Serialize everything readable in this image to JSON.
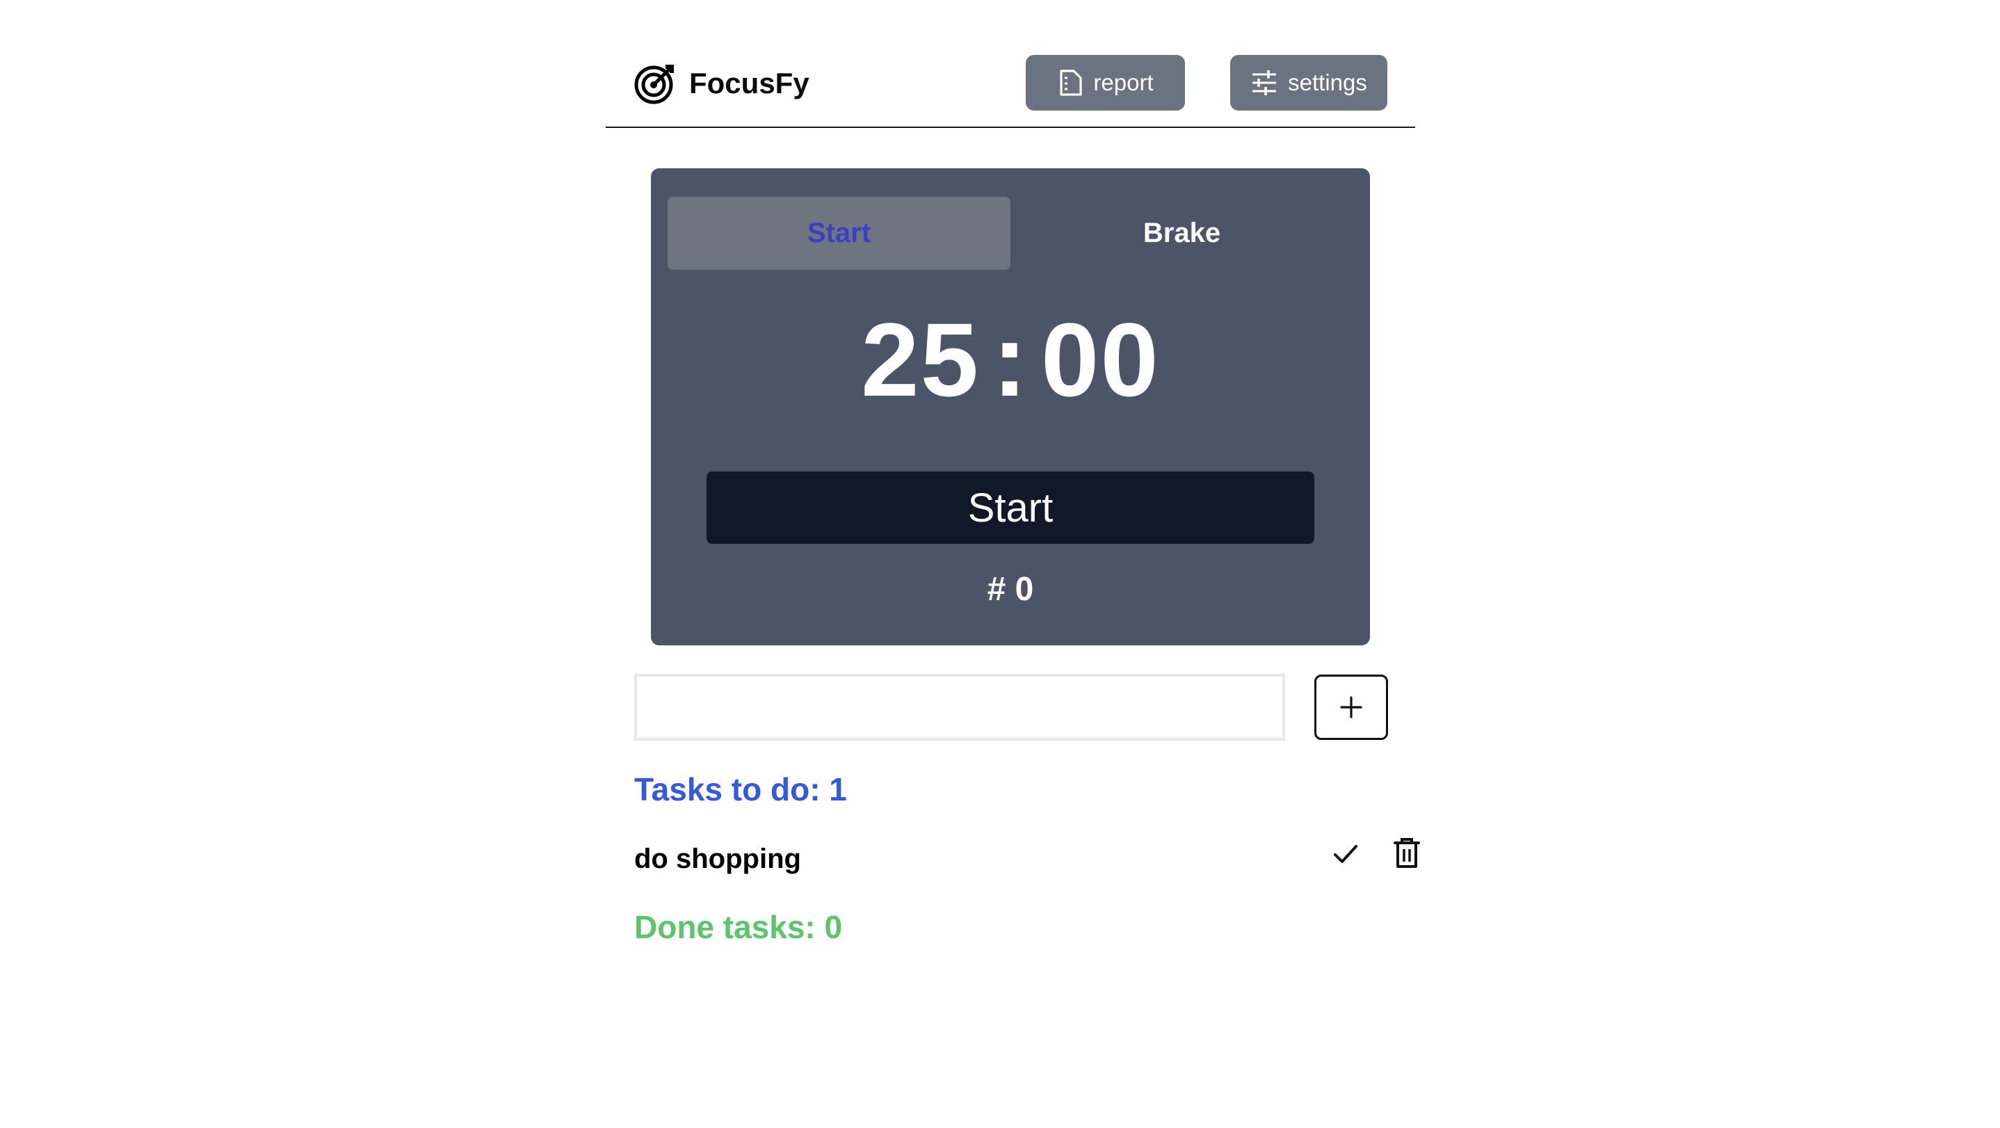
{
  "header": {
    "app_name": "FocusFy",
    "logo_icon": "target-arrow-icon",
    "report_label": "report",
    "report_icon": "document-icon",
    "settings_label": "settings",
    "settings_icon": "sliders-icon"
  },
  "timer": {
    "tabs": [
      {
        "label": "Start",
        "active": true
      },
      {
        "label": "Brake",
        "active": false
      }
    ],
    "minutes": "25",
    "separator": ":",
    "seconds": "00",
    "start_button_label": "Start",
    "round_label": "# 0"
  },
  "task_input": {
    "value": "",
    "placeholder": "",
    "add_icon": "plus-icon"
  },
  "todo": {
    "title": "Tasks to do: 1",
    "items": [
      {
        "text": "do shopping",
        "complete_icon": "check-icon",
        "delete_icon": "trash-icon"
      }
    ]
  },
  "done": {
    "title": "Done tasks: 0"
  },
  "colors": {
    "card_bg": "#4b5567",
    "active_tab_bg": "#6f7580",
    "active_tab_text": "#3b3fc4",
    "start_button_bg": "#111827",
    "header_button_bg": "#6b7280",
    "todo_title": "#3558e0",
    "done_title": "#5cc46a"
  }
}
